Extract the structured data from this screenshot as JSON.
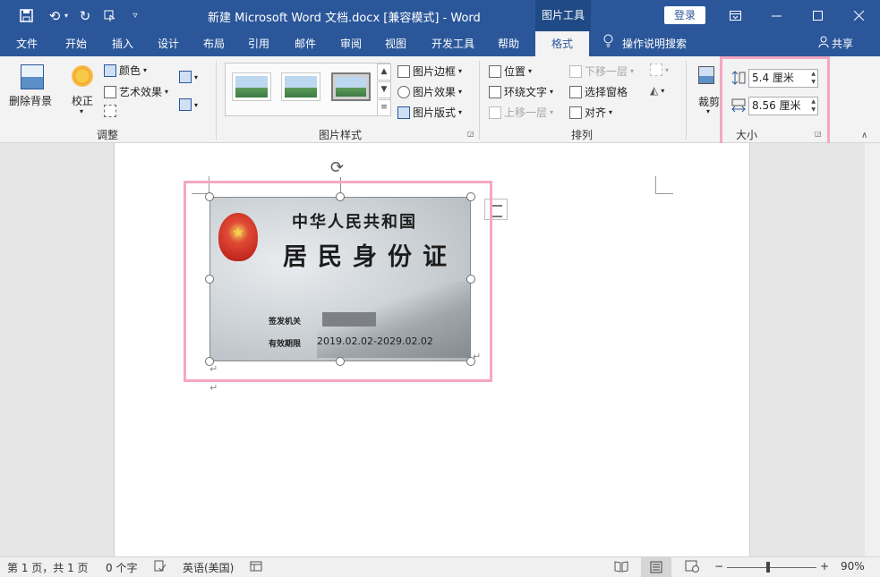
{
  "titlebar": {
    "title": "新建 Microsoft Word 文档.docx [兼容模式]  -  Word",
    "context_tab": "图片工具",
    "login": "登录",
    "icons": {
      "save": "save-icon",
      "undo": "undo-icon",
      "redo": "redo-icon",
      "touch": "touch-mode-icon",
      "customize": "customize-icon"
    }
  },
  "tabs": [
    "文件",
    "开始",
    "插入",
    "设计",
    "布局",
    "引用",
    "邮件",
    "审阅",
    "视图",
    "开发工具",
    "帮助",
    "格式"
  ],
  "active_tab": "格式",
  "tell_me": "操作说明搜索",
  "share": "共享",
  "ribbon": {
    "adjust": {
      "remove_bg": "删除背景",
      "correct": "校正",
      "color": "颜色",
      "artistic": "艺术效果",
      "label": "调整"
    },
    "styles": {
      "border": "图片边框",
      "effects": "图片效果",
      "layout": "图片版式",
      "label": "图片样式"
    },
    "arrange": {
      "position": "位置",
      "wrap": "环绕文字",
      "bring_forward": "上移一层",
      "send_backward": "下移一层",
      "selection_pane": "选择窗格",
      "align": "对齐",
      "label": "排列"
    },
    "size": {
      "crop": "裁剪",
      "height": "5.4 厘米",
      "width": "8.56 厘米",
      "label": "大小"
    }
  },
  "card": {
    "line1": "中华人民共和国",
    "line2": "居民身份证",
    "issuer_label": "签发机关",
    "validity_label": "有效期限",
    "validity_value": "2019.02.02-2029.02.02"
  },
  "paragraph_mark": "↵",
  "status": {
    "page": "第 1 页，共 1 页",
    "words": "0 个字",
    "language": "英语(美国)",
    "zoom": "90%",
    "zoom_minus": "−",
    "zoom_plus": "+"
  }
}
